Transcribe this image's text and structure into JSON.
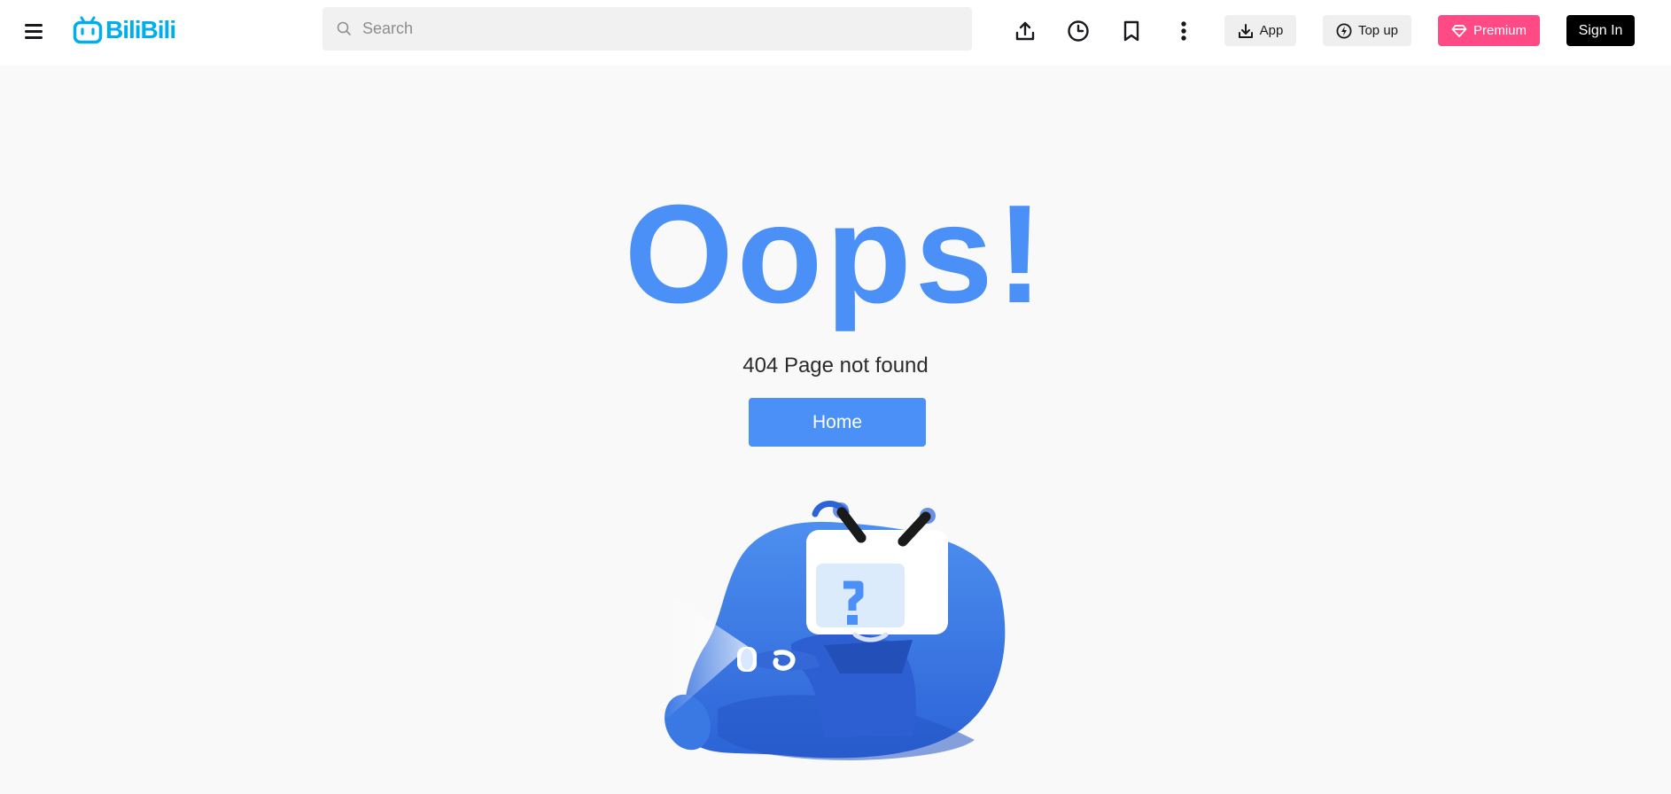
{
  "header": {
    "logo_text": "BiliBili",
    "search_placeholder": "Search",
    "icons": [
      "menu-icon",
      "search-icon",
      "upload-icon",
      "history-icon",
      "bookmark-icon",
      "more-icon"
    ],
    "app_label": "App",
    "topup_label": "Top up",
    "premium_label": "Premium",
    "signin_label": "Sign In"
  },
  "main": {
    "headline": "Oops!",
    "message": "404 Page not found",
    "home_label": "Home",
    "illustration_glyph": "?"
  },
  "colors": {
    "brand": "#00aeec",
    "accent": "#4a90f7",
    "premium": "#ff4a85",
    "signin": "#000000"
  }
}
